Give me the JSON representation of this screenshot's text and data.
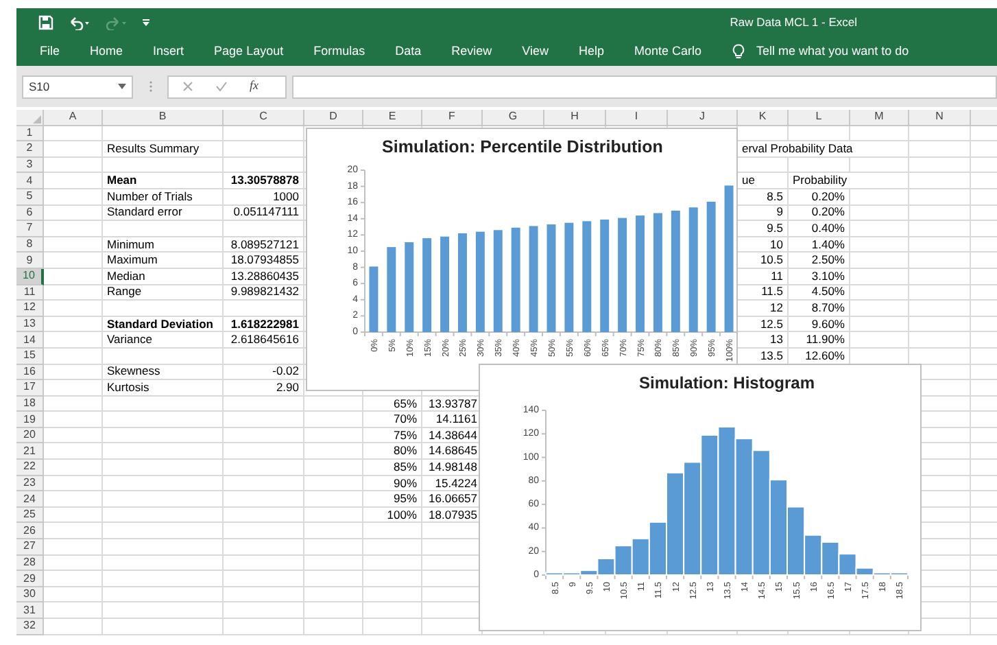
{
  "window": {
    "title": "Raw Data MCL 1  -  Excel"
  },
  "ribbon": {
    "tabs": [
      "File",
      "Home",
      "Insert",
      "Page Layout",
      "Formulas",
      "Data",
      "Review",
      "View",
      "Help",
      "Monte Carlo"
    ],
    "tell_me": "Tell me what you want to do"
  },
  "formula_bar": {
    "name_box": "S10",
    "function_label": "fx"
  },
  "sheet": {
    "columns": [
      "A",
      "B",
      "C",
      "D",
      "E",
      "F",
      "G",
      "H",
      "I",
      "J",
      "K",
      "L",
      "M",
      "N"
    ],
    "rows": [
      {
        "label": "1",
        "selected": false,
        "cells": {}
      },
      {
        "label": "2",
        "selected": false,
        "cells": {
          "B": {
            "text": "Results Summary",
            "kind": "text",
            "bold": false
          },
          "K": {
            "text": "erval Probability Data",
            "kind": "text",
            "bold": false
          }
        }
      },
      {
        "label": "3",
        "selected": false,
        "cells": {}
      },
      {
        "label": "4",
        "selected": false,
        "cells": {
          "B": {
            "text": "Mean",
            "kind": "text",
            "bold": true
          },
          "C": {
            "text": "13.30578878",
            "kind": "number",
            "bold": true
          },
          "K": {
            "text": "ue",
            "kind": "text",
            "bold": false
          },
          "L": {
            "text": "Probability",
            "kind": "text",
            "bold": false
          }
        }
      },
      {
        "label": "5",
        "selected": false,
        "cells": {
          "B": {
            "text": "Number of Trials",
            "kind": "text",
            "bold": false
          },
          "C": {
            "text": "1000",
            "kind": "number",
            "bold": false
          },
          "K": {
            "text": "8.5",
            "kind": "number",
            "bold": false
          },
          "L": {
            "text": "0.20%",
            "kind": "number",
            "bold": false
          }
        }
      },
      {
        "label": "6",
        "selected": false,
        "cells": {
          "B": {
            "text": "Standard error",
            "kind": "text",
            "bold": false
          },
          "C": {
            "text": "0.051147111",
            "kind": "number",
            "bold": false
          },
          "K": {
            "text": "9",
            "kind": "number",
            "bold": false
          },
          "L": {
            "text": "0.20%",
            "kind": "number",
            "bold": false
          }
        }
      },
      {
        "label": "7",
        "selected": false,
        "cells": {
          "K": {
            "text": "9.5",
            "kind": "number",
            "bold": false
          },
          "L": {
            "text": "0.40%",
            "kind": "number",
            "bold": false
          }
        }
      },
      {
        "label": "8",
        "selected": false,
        "cells": {
          "B": {
            "text": "Minimum",
            "kind": "text",
            "bold": false
          },
          "C": {
            "text": "8.089527121",
            "kind": "number",
            "bold": false
          },
          "K": {
            "text": "10",
            "kind": "number",
            "bold": false
          },
          "L": {
            "text": "1.40%",
            "kind": "number",
            "bold": false
          }
        }
      },
      {
        "label": "9",
        "selected": false,
        "cells": {
          "B": {
            "text": "Maximum",
            "kind": "text",
            "bold": false
          },
          "C": {
            "text": "18.07934855",
            "kind": "number",
            "bold": false
          },
          "K": {
            "text": "10.5",
            "kind": "number",
            "bold": false
          },
          "L": {
            "text": "2.50%",
            "kind": "number",
            "bold": false
          }
        }
      },
      {
        "label": "10",
        "selected": true,
        "cells": {
          "B": {
            "text": "Median",
            "kind": "text",
            "bold": false
          },
          "C": {
            "text": "13.28860435",
            "kind": "number",
            "bold": false
          },
          "K": {
            "text": "11",
            "kind": "number",
            "bold": false
          },
          "L": {
            "text": "3.10%",
            "kind": "number",
            "bold": false
          }
        }
      },
      {
        "label": "11",
        "selected": false,
        "cells": {
          "B": {
            "text": "Range",
            "kind": "text",
            "bold": false
          },
          "C": {
            "text": "9.989821432",
            "kind": "number",
            "bold": false
          },
          "K": {
            "text": "11.5",
            "kind": "number",
            "bold": false
          },
          "L": {
            "text": "4.50%",
            "kind": "number",
            "bold": false
          }
        }
      },
      {
        "label": "12",
        "selected": false,
        "cells": {
          "K": {
            "text": "12",
            "kind": "number",
            "bold": false
          },
          "L": {
            "text": "8.70%",
            "kind": "number",
            "bold": false
          }
        }
      },
      {
        "label": "13",
        "selected": false,
        "cells": {
          "B": {
            "text": "Standard Deviation",
            "kind": "text",
            "bold": true
          },
          "C": {
            "text": "1.618222981",
            "kind": "number",
            "bold": true
          },
          "K": {
            "text": "12.5",
            "kind": "number",
            "bold": false
          },
          "L": {
            "text": "9.60%",
            "kind": "number",
            "bold": false
          }
        }
      },
      {
        "label": "14",
        "selected": false,
        "cells": {
          "B": {
            "text": "Variance",
            "kind": "text",
            "bold": false
          },
          "C": {
            "text": "2.618645616",
            "kind": "number",
            "bold": false
          },
          "K": {
            "text": "13",
            "kind": "number",
            "bold": false
          },
          "L": {
            "text": "11.90%",
            "kind": "number",
            "bold": false
          }
        }
      },
      {
        "label": "15",
        "selected": false,
        "cells": {
          "K": {
            "text": "13.5",
            "kind": "number",
            "bold": false
          },
          "L": {
            "text": "12.60%",
            "kind": "number",
            "bold": false
          }
        }
      },
      {
        "label": "16",
        "selected": false,
        "cells": {
          "B": {
            "text": "Skewness",
            "kind": "text",
            "bold": false
          },
          "C": {
            "text": "-0.02",
            "kind": "number",
            "bold": false
          }
        }
      },
      {
        "label": "17",
        "selected": false,
        "cells": {
          "B": {
            "text": "Kurtosis",
            "kind": "text",
            "bold": false
          },
          "C": {
            "text": "2.90",
            "kind": "number",
            "bold": false
          }
        }
      },
      {
        "label": "18",
        "selected": false,
        "cells": {
          "E": {
            "text": "65%",
            "kind": "number",
            "bold": false
          },
          "F": {
            "text": "13.93787",
            "kind": "number",
            "bold": false
          }
        }
      },
      {
        "label": "19",
        "selected": false,
        "cells": {
          "E": {
            "text": "70%",
            "kind": "number",
            "bold": false
          },
          "F": {
            "text": "14.1161",
            "kind": "number",
            "bold": false
          }
        }
      },
      {
        "label": "20",
        "selected": false,
        "cells": {
          "E": {
            "text": "75%",
            "kind": "number",
            "bold": false
          },
          "F": {
            "text": "14.38644",
            "kind": "number",
            "bold": false
          }
        }
      },
      {
        "label": "21",
        "selected": false,
        "cells": {
          "E": {
            "text": "80%",
            "kind": "number",
            "bold": false
          },
          "F": {
            "text": "14.68645",
            "kind": "number",
            "bold": false
          }
        }
      },
      {
        "label": "22",
        "selected": false,
        "cells": {
          "E": {
            "text": "85%",
            "kind": "number",
            "bold": false
          },
          "F": {
            "text": "14.98148",
            "kind": "number",
            "bold": false
          }
        }
      },
      {
        "label": "23",
        "selected": false,
        "cells": {
          "E": {
            "text": "90%",
            "kind": "number",
            "bold": false
          },
          "F": {
            "text": "15.4224",
            "kind": "number",
            "bold": false
          }
        }
      },
      {
        "label": "24",
        "selected": false,
        "cells": {
          "E": {
            "text": "95%",
            "kind": "number",
            "bold": false
          },
          "F": {
            "text": "16.06657",
            "kind": "number",
            "bold": false
          }
        }
      },
      {
        "label": "25",
        "selected": false,
        "cells": {
          "E": {
            "text": "100%",
            "kind": "number",
            "bold": false
          },
          "F": {
            "text": "18.07935",
            "kind": "number",
            "bold": false
          }
        }
      },
      {
        "label": "26",
        "selected": false,
        "cells": {}
      },
      {
        "label": "27",
        "selected": false,
        "cells": {}
      },
      {
        "label": "28",
        "selected": false,
        "cells": {}
      },
      {
        "label": "29",
        "selected": false,
        "cells": {}
      },
      {
        "label": "30",
        "selected": false,
        "cells": {}
      },
      {
        "label": "31",
        "selected": false,
        "cells": {}
      },
      {
        "label": "32",
        "selected": false,
        "cells": {}
      }
    ]
  },
  "charts": [
    {
      "chart_data": {
        "type": "bar",
        "title": "Simulation: Percentile Distribution",
        "categories": [
          "0%",
          "5%",
          "10%",
          "15%",
          "20%",
          "25%",
          "30%",
          "35%",
          "40%",
          "45%",
          "50%",
          "55%",
          "60%",
          "65%",
          "70%",
          "75%",
          "80%",
          "85%",
          "90%",
          "95%",
          "100%"
        ],
        "series": [
          {
            "color": "#5b9bd5",
            "values": [
              8.1,
              10.5,
              11.1,
              11.6,
              11.8,
              12.2,
              12.4,
              12.6,
              12.9,
              13.1,
              13.3,
              13.5,
              13.7,
              13.9,
              14.1,
              14.4,
              14.7,
              15,
              15.4,
              16.1,
              18.1
            ]
          }
        ],
        "ylim": [
          0,
          20
        ],
        "yticks": [
          0,
          2,
          4,
          6,
          8,
          10,
          12,
          14,
          16,
          18,
          20
        ]
      }
    },
    {
      "chart_data": {
        "type": "bar",
        "title": "Simulation: Histogram",
        "categories": [
          "8.5",
          "9",
          "9.5",
          "10",
          "10.5",
          "11",
          "11.5",
          "12",
          "12.5",
          "13",
          "13.5",
          "14",
          "14.5",
          "15",
          "15.5",
          "16",
          "16.5",
          "17",
          "17.5",
          "18",
          "18.5"
        ],
        "series": [
          {
            "color": "#5b9bd5",
            "values": [
              2,
              2,
              4,
              14,
              25,
              31,
              45,
              87,
              96,
              119,
              126,
              116,
              106,
              81,
              58,
              34,
              28,
              18,
              6,
              2,
              2
            ]
          }
        ],
        "ylim": [
          0,
          140
        ],
        "yticks": [
          0,
          20,
          40,
          60,
          80,
          100,
          120,
          140
        ]
      }
    }
  ]
}
